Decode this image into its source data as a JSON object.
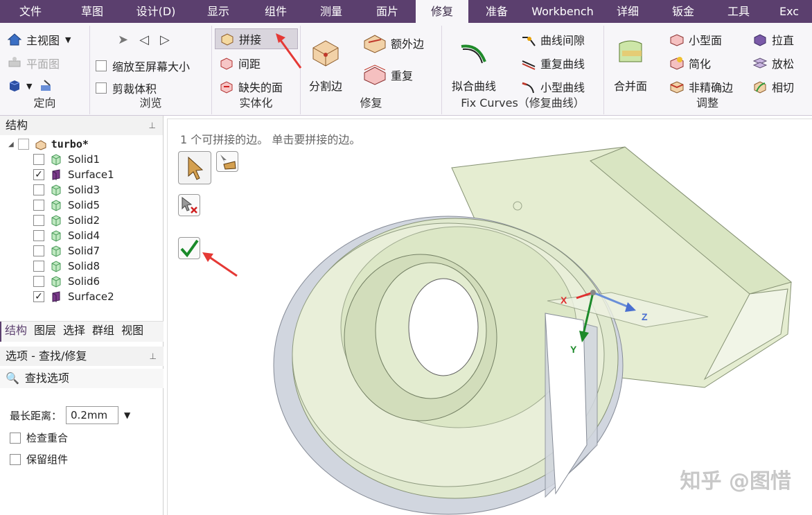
{
  "menu": [
    "文件",
    "草图",
    "设计(D)",
    "显示",
    "组件",
    "测量",
    "面片",
    "修复",
    "准备",
    "Workbench",
    "详细",
    "钣金",
    "工具",
    "Exc"
  ],
  "ribbon": {
    "orient": {
      "label": "定向",
      "home": "主视图",
      "plan": "平面图"
    },
    "browse": {
      "label": "浏览",
      "zoom": "缩放至屏幕大小",
      "clip": "剪裁体积"
    },
    "solidify": {
      "label": "实体化",
      "stitch": "拼接",
      "gap": "间距",
      "missing": "缺失的面"
    },
    "repair": {
      "label": "修复",
      "split": "分割边",
      "extra": "额外边",
      "dup": "重复"
    },
    "fix": {
      "label": "Fix Curves（修复曲线）",
      "fit": "拟合曲线",
      "curvegap": "曲线间隙",
      "dupcurve": "重复曲线",
      "smallcurve": "小型曲线"
    },
    "adjust": {
      "label": "调整",
      "merge": "合并面",
      "smallface": "小型面",
      "simplify": "简化",
      "inexact": "非精确边",
      "straighten": "拉直",
      "relax": "放松",
      "tangent": "相切"
    }
  },
  "structure": {
    "title": "结构",
    "root": "turbo*",
    "items": [
      {
        "name": "Solid1",
        "checked": false,
        "kind": "solid"
      },
      {
        "name": "Surface1",
        "checked": true,
        "kind": "surface"
      },
      {
        "name": "Solid3",
        "checked": false,
        "kind": "solid"
      },
      {
        "name": "Solid5",
        "checked": false,
        "kind": "solid"
      },
      {
        "name": "Solid2",
        "checked": false,
        "kind": "solid"
      },
      {
        "name": "Solid4",
        "checked": false,
        "kind": "solid"
      },
      {
        "name": "Solid7",
        "checked": false,
        "kind": "solid"
      },
      {
        "name": "Solid8",
        "checked": false,
        "kind": "solid"
      },
      {
        "name": "Solid6",
        "checked": false,
        "kind": "solid"
      },
      {
        "name": "Surface2",
        "checked": true,
        "kind": "surface"
      }
    ]
  },
  "tabs": [
    "结构",
    "图层",
    "选择",
    "群组",
    "视图"
  ],
  "options": {
    "title": "选项 - 查找/修复",
    "find": "查找选项",
    "maxdist_label": "最长距离：",
    "maxdist_value": "0.2mm",
    "check_overlap": "检查重合",
    "keep_comp": "保留组件"
  },
  "viewport": {
    "status": "1 个可拼接的边。 单击要拼接的边。",
    "axis_x": "X",
    "axis_y": "Y",
    "axis_z": "Z",
    "watermark": "知乎 @图惜"
  },
  "colors": {
    "menubar": "#5b3f6e",
    "accent": "#e53935",
    "model": "#dfe9c6"
  }
}
